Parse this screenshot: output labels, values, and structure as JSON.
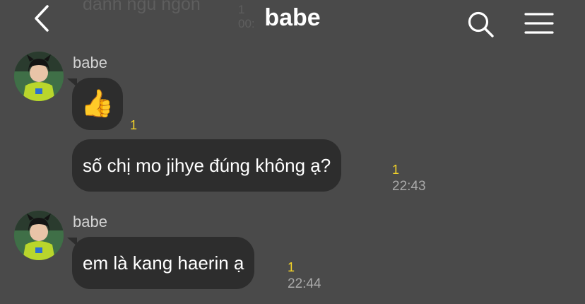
{
  "header": {
    "title": "babe",
    "back_icon": "chevron-left-icon",
    "search_icon": "search-icon",
    "menu_icon": "hamburger-menu-icon"
  },
  "background_peek": {
    "text": "danh ngủ ngon",
    "unread": "1",
    "time": "00:"
  },
  "messages": [
    {
      "sender": "babe",
      "bubbles": [
        {
          "content": "👍",
          "unread": "1",
          "time": ""
        },
        {
          "content": "số chị mo jihye đúng không ạ?",
          "unread": "1",
          "time": "22:43"
        }
      ]
    },
    {
      "sender": "babe",
      "bubbles": [
        {
          "content": "em là kang haerin ạ",
          "unread": "1",
          "time": "22:44"
        }
      ]
    }
  ],
  "colors": {
    "background": "#4a4a4a",
    "bubble": "#2d2d2d",
    "unread": "#f3d328",
    "time": "#a9a9a9"
  }
}
